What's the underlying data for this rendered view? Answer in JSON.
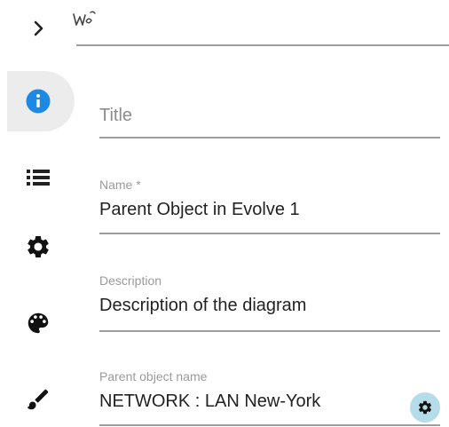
{
  "header": {
    "expand_icon": "chevron-right-icon",
    "scribble_icon": "scribble-icon"
  },
  "sidebar": {
    "items": [
      {
        "name": "info",
        "icon": "info-icon",
        "active": true,
        "color": "#1e88e5"
      },
      {
        "name": "list",
        "icon": "list-icon",
        "active": false
      },
      {
        "name": "settings",
        "icon": "gear-icon",
        "active": false
      },
      {
        "name": "palette",
        "icon": "palette-icon",
        "active": false
      },
      {
        "name": "brush",
        "icon": "brush-icon",
        "active": false
      }
    ]
  },
  "form": {
    "title": {
      "placeholder": "Title",
      "value": ""
    },
    "name": {
      "label": "Name *",
      "value": "Parent Object in Evolve 1"
    },
    "description": {
      "label": "Description",
      "value": "Description of the diagram"
    },
    "parent": {
      "label": "Parent object name",
      "value": "NETWORK : LAN New-York",
      "action_icon": "gear-icon",
      "action_color": "#b7dce9"
    }
  }
}
